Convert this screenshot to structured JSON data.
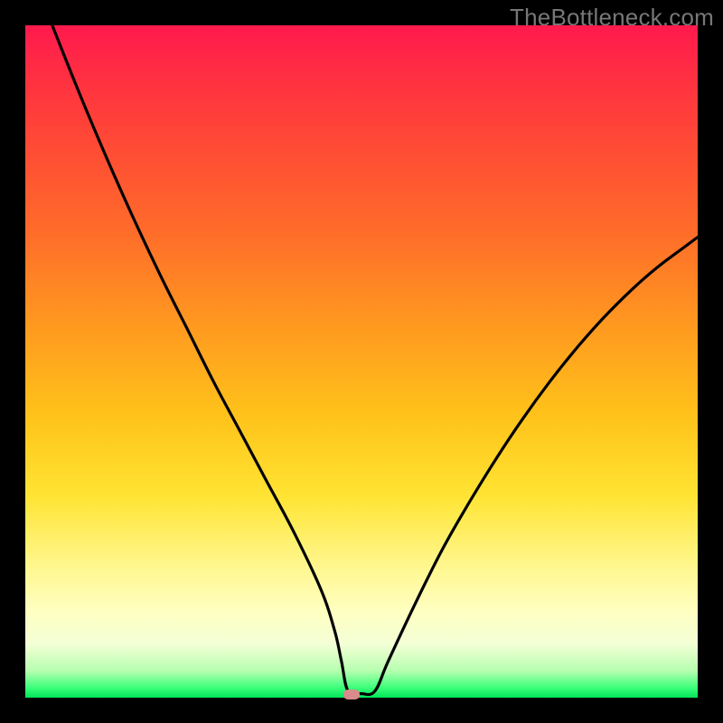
{
  "watermark": "TheBottleneck.com",
  "colors": {
    "page_bg": "#000000",
    "gradient_top": "#ff1a4d",
    "gradient_bottom": "#00e45a",
    "curve": "#000000",
    "marker": "#d98a8a"
  },
  "chart_data": {
    "type": "line",
    "title": "",
    "xlabel": "",
    "ylabel": "",
    "xlim": [
      0,
      100
    ],
    "ylim": [
      0,
      100
    ],
    "grid": false,
    "legend": false,
    "series": [
      {
        "name": "bottleneck-curve",
        "x": [
          4,
          8,
          12,
          16,
          20,
          24,
          28,
          32,
          36,
          40,
          44,
          46,
          47,
          48,
          50,
          52,
          54,
          58,
          62,
          66,
          70,
          74,
          78,
          82,
          86,
          90,
          94,
          98,
          100
        ],
        "y": [
          100,
          90,
          80.5,
          71.5,
          63,
          55,
          47,
          39.5,
          32,
          24.5,
          16,
          10,
          5.5,
          1,
          0.6,
          1,
          5.5,
          14,
          22,
          29,
          35.5,
          41.5,
          47,
          52,
          56.5,
          60.5,
          64,
          67,
          68.5
        ]
      }
    ],
    "marker": {
      "x": 48.5,
      "y": 0.6
    },
    "notes": "Values are read off the plotted V-shaped curve relative to the gradient plot area; no numeric axes are shown so values are percentage positions (0,0 at bottom-left)."
  }
}
